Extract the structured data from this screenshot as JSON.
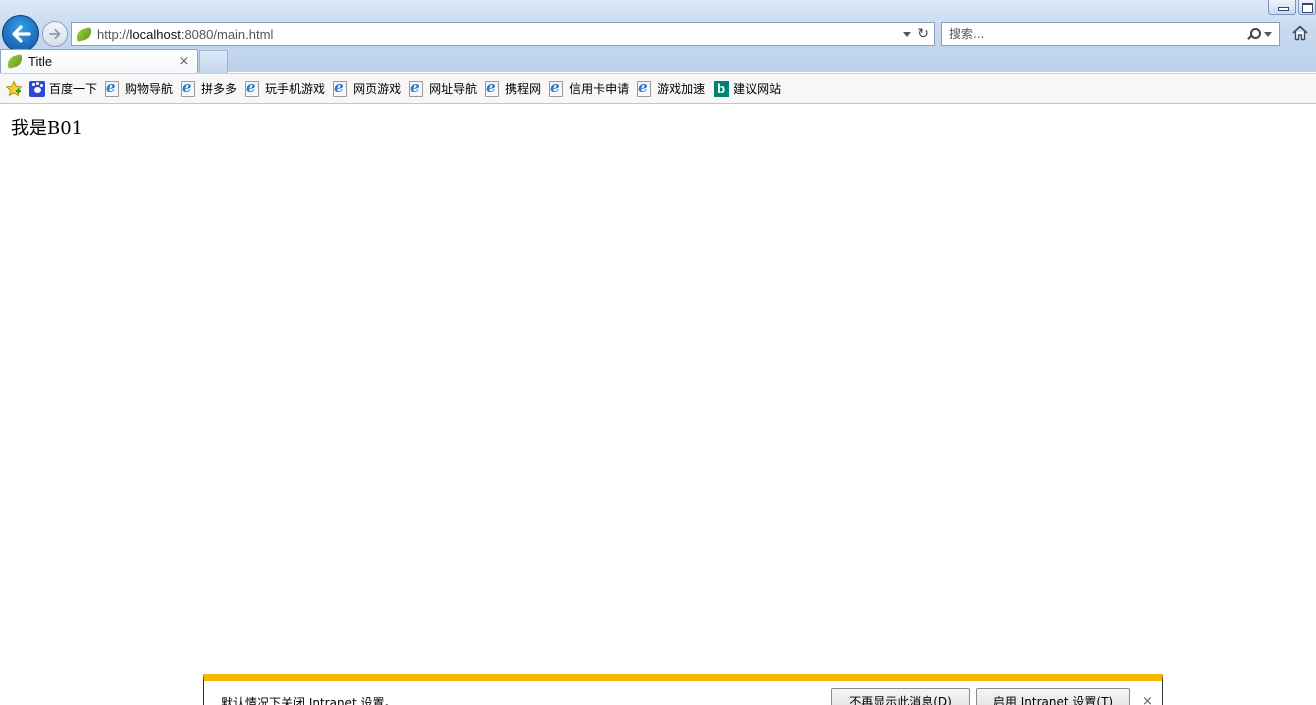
{
  "browser": {
    "address": {
      "scheme": "http://",
      "host": "localhost",
      "rest": ":8080/main.html"
    },
    "search": {
      "placeholder": "搜索..."
    },
    "tab": {
      "title": "Title",
      "close": "×"
    }
  },
  "favorites": [
    {
      "label": "百度一下",
      "icon": "baidu-paw-icon"
    },
    {
      "label": "购物导航",
      "icon": "ie-icon"
    },
    {
      "label": "拼多多",
      "icon": "ie-icon"
    },
    {
      "label": "玩手机游戏",
      "icon": "ie-icon"
    },
    {
      "label": "网页游戏",
      "icon": "ie-icon"
    },
    {
      "label": "网址导航",
      "icon": "ie-icon"
    },
    {
      "label": "携程网",
      "icon": "ie-icon"
    },
    {
      "label": "信用卡申请",
      "icon": "ie-icon"
    },
    {
      "label": "游戏加速",
      "icon": "ie-icon"
    },
    {
      "label": "建议网站",
      "icon": "bing-icon"
    }
  ],
  "page": {
    "text": "我是B01"
  },
  "notification": {
    "message": "默认情况下关闭 Intranet 设置。",
    "dont_show_label": "不再显示此消息(D)",
    "enable_label": "启用 Intranet 设置(T)",
    "close": "×"
  },
  "colors": {
    "accent": "#1c6fbf",
    "notify_stripe": "#f5b700",
    "bing": "#008373"
  }
}
